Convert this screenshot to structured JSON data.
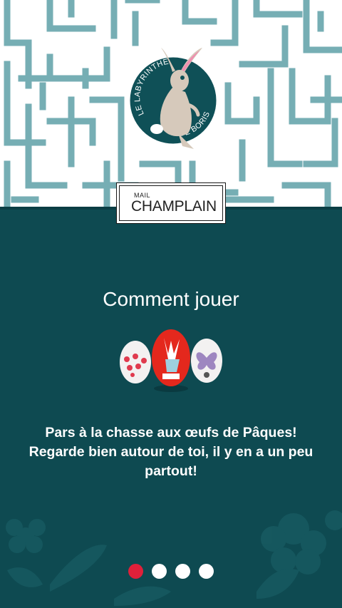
{
  "header": {
    "logo_arc_left": "LE LABYRINTHE",
    "logo_arc_right": "DE BORIS",
    "brand_small": "MAIL",
    "brand_name": "CHAMPLAIN"
  },
  "main": {
    "title": "Comment jouer",
    "instructions": "Pars à la chasse aux œufs de Pâques! Regarde bien autour de toi, il y en a un peu partout!"
  },
  "pager": {
    "pages": 4,
    "current": 1
  },
  "colors": {
    "background": "#0e4a51",
    "maze_wall": "#76aeb4",
    "badge": "#0f5057",
    "active_dot": "#e0203a",
    "inactive_dot": "#ffffff"
  }
}
